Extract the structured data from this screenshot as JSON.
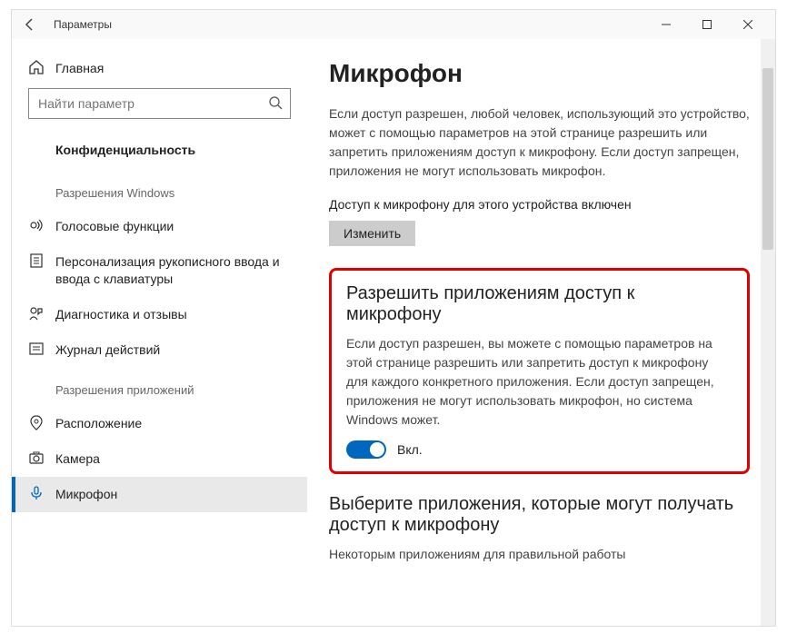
{
  "titlebar": {
    "title": "Параметры"
  },
  "sidebar": {
    "home": "Главная",
    "search_placeholder": "Найти параметр",
    "category": "Конфиденциальность",
    "sections": [
      {
        "header": "Разрешения Windows",
        "items": [
          {
            "id": "voice",
            "label": "Голосовые функции"
          },
          {
            "id": "inking",
            "label": "Персонализация рукописного ввода и ввода с клавиатуры"
          },
          {
            "id": "diag",
            "label": "Диагностика и отзывы"
          },
          {
            "id": "activity",
            "label": "Журнал действий"
          }
        ]
      },
      {
        "header": "Разрешения приложений",
        "items": [
          {
            "id": "location",
            "label": "Расположение"
          },
          {
            "id": "camera",
            "label": "Камера"
          },
          {
            "id": "microphone",
            "label": "Микрофон",
            "active": true
          }
        ]
      }
    ]
  },
  "main": {
    "title": "Микрофон",
    "intro": "Если доступ разрешен, любой человек, использующий это устройство, может с помощью параметров на этой странице разрешить или запретить приложениям доступ к микрофону. Если доступ запрещен, приложения не могут использовать микрофон.",
    "access_status": "Доступ к микрофону для этого устройства включен",
    "change_label": "Изменить",
    "allow_title": "Разрешить приложениям доступ к микрофону",
    "allow_text": "Если доступ разрешен, вы можете с помощью параметров на этой странице разрешить или запретить доступ к микрофону для каждого конкретного приложения. Если доступ запрещен, приложения не могут использовать микрофон, но система Windows может.",
    "toggle_state": "Вкл.",
    "choose_title": "Выберите приложения, которые могут получать доступ к микрофону",
    "choose_text": "Некоторым приложениям для правильной работы"
  }
}
